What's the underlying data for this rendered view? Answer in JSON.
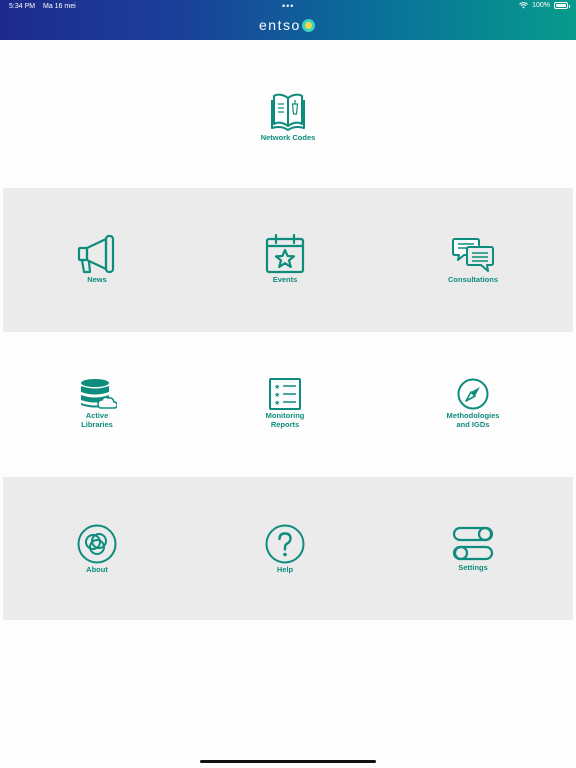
{
  "status_bar": {
    "time": "5:34 PM",
    "date": "Ma 16 mei",
    "dots": "•••",
    "battery": "100%"
  },
  "header": {
    "logo_text": "entso"
  },
  "colors": {
    "accent": "#0e8c7d",
    "band": "#ebebeb",
    "header_start": "#1d2a8c",
    "header_end": "#079c8c"
  },
  "tiles": [
    {
      "label": "Network Codes",
      "icon": "book-icon"
    },
    {
      "label": "News",
      "icon": "megaphone-icon"
    },
    {
      "label": "Events",
      "icon": "calendar-star-icon"
    },
    {
      "label": "Consultations",
      "icon": "chat-bubbles-icon"
    },
    {
      "label": "Active\nLibraries",
      "icon": "database-cloud-icon"
    },
    {
      "label": "Monitoring\nReports",
      "icon": "checklist-icon"
    },
    {
      "label": "Methodologies\nand IGDs",
      "icon": "compass-icon"
    },
    {
      "label": "About",
      "icon": "circles-logo-icon"
    },
    {
      "label": "Help",
      "icon": "question-circle-icon"
    },
    {
      "label": "Settings",
      "icon": "toggles-icon"
    }
  ]
}
